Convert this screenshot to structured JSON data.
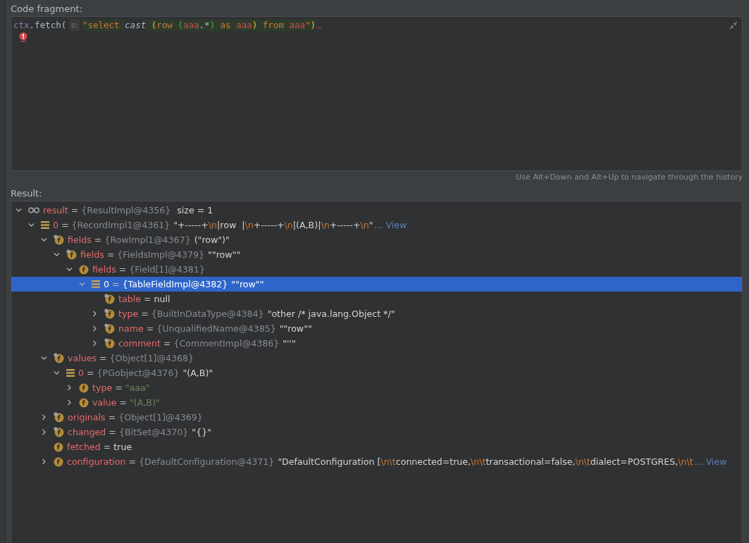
{
  "code_fragment": {
    "label": "Code fragment:",
    "tokens": [
      {
        "text": "ctx",
        "kind": "ident"
      },
      {
        "text": ".fetch(",
        "kind": "plain"
      },
      {
        "text": "s:",
        "kind": "hint"
      },
      {
        "text": "\"select ",
        "kind": "sqlkw"
      },
      {
        "text": "cast",
        "kind": "sqlfn"
      },
      {
        "text": " (",
        "kind": "paren1"
      },
      {
        "text": "row ",
        "kind": "sqlkw"
      },
      {
        "text": "(",
        "kind": "paren2"
      },
      {
        "text": "aaa",
        "kind": "table"
      },
      {
        "text": ".*",
        "kind": "op"
      },
      {
        "text": ")",
        "kind": "paren2"
      },
      {
        "text": " as ",
        "kind": "sqlkw"
      },
      {
        "text": "aaa",
        "kind": "table"
      },
      {
        "text": ")",
        "kind": "paren1"
      },
      {
        "text": " from ",
        "kind": "sqlkw"
      },
      {
        "text": "aaa",
        "kind": "table"
      },
      {
        "text": "\"",
        "kind": "sqlkw"
      },
      {
        "text": ")",
        "kind": "paren1"
      }
    ],
    "history_hint": "Use Alt+Down and Alt+Up to navigate through the history"
  },
  "result": {
    "label": "Result:",
    "tree": [
      {
        "kind": "watch",
        "name": "result",
        "eq": "=",
        "type": "{ResultImpl@4356}",
        "value": [
          {
            "text": " size = 1",
            "kind": "plain"
          }
        ],
        "expanded": true,
        "selected": false,
        "children": [
          {
            "kind": "array",
            "name": "0",
            "eq": "=",
            "type": "{RecordImpl1@4361}",
            "value": [
              {
                "text": "\"+-----+",
                "kind": "plain"
              },
              {
                "text": "\\n",
                "kind": "escape"
              },
              {
                "text": "|row  |",
                "kind": "plain"
              },
              {
                "text": "\\n",
                "kind": "escape"
              },
              {
                "text": "+-----+",
                "kind": "plain"
              },
              {
                "text": "\\n",
                "kind": "escape"
              },
              {
                "text": "|(A,B)|",
                "kind": "plain"
              },
              {
                "text": "\\n",
                "kind": "escape"
              },
              {
                "text": "+-----+",
                "kind": "plain"
              },
              {
                "text": "\\n",
                "kind": "escape"
              },
              {
                "text": "\"",
                "kind": "plain"
              }
            ],
            "more": "...",
            "link": "View",
            "expanded": true,
            "selected": false,
            "children": [
              {
                "kind": "field-final",
                "name": "fields",
                "eq": "=",
                "type": "{RowImpl1@4367}",
                "value": [
                  {
                    "text": "(\"row\")\"",
                    "kind": "plain"
                  }
                ],
                "expanded": true,
                "selected": false,
                "children": [
                  {
                    "kind": "field-final",
                    "name": "fields",
                    "eq": "=",
                    "type": "{FieldsImpl@4379}",
                    "value": [
                      {
                        "text": "\"\"row\"\"",
                        "kind": "plain"
                      }
                    ],
                    "expanded": true,
                    "selected": false,
                    "children": [
                      {
                        "kind": "field",
                        "name": "fields",
                        "eq": "=",
                        "type": "{Field[1]@4381}",
                        "expanded": true,
                        "selected": false,
                        "children": [
                          {
                            "kind": "array",
                            "name": "0",
                            "eq": "=",
                            "type": "{TableFieldImpl@4382}",
                            "value": [
                              {
                                "text": "\"\"row\"\"",
                                "kind": "plain"
                              }
                            ],
                            "expanded": true,
                            "selected": true,
                            "children": [
                              {
                                "kind": "field-final",
                                "name": "table",
                                "eq": "=",
                                "value": [
                                  {
                                    "text": "null",
                                    "kind": "plain"
                                  }
                                ],
                                "selected": false
                              },
                              {
                                "kind": "field-final",
                                "name": "type",
                                "eq": "=",
                                "type": "{BuiltInDataType@4384}",
                                "value": [
                                  {
                                    "text": "\"other /* java.lang.Object */\"",
                                    "kind": "plain"
                                  }
                                ],
                                "expanded": false,
                                "selected": false
                              },
                              {
                                "kind": "field-final",
                                "name": "name",
                                "eq": "=",
                                "type": "{UnqualifiedName@4385}",
                                "value": [
                                  {
                                    "text": "\"\"row\"\"",
                                    "kind": "plain"
                                  }
                                ],
                                "expanded": false,
                                "selected": false
                              },
                              {
                                "kind": "field-final",
                                "name": "comment",
                                "eq": "=",
                                "type": "{CommentImpl@4386}",
                                "value": [
                                  {
                                    "text": "\"''\"",
                                    "kind": "plain"
                                  }
                                ],
                                "expanded": false,
                                "selected": false
                              }
                            ]
                          }
                        ]
                      }
                    ]
                  }
                ]
              },
              {
                "kind": "field-final",
                "name": "values",
                "eq": "=",
                "type": "{Object[1]@4368}",
                "expanded": true,
                "selected": false,
                "children": [
                  {
                    "kind": "array",
                    "name": "0",
                    "eq": "=",
                    "type": "{PGobject@4376}",
                    "value": [
                      {
                        "text": "\"(A,B)\"",
                        "kind": "plain"
                      }
                    ],
                    "expanded": true,
                    "selected": false,
                    "children": [
                      {
                        "kind": "field",
                        "name": "type",
                        "eq": "=",
                        "value": [
                          {
                            "text": "\"aaa\"",
                            "kind": "string"
                          }
                        ],
                        "expanded": false,
                        "selected": false
                      },
                      {
                        "kind": "field",
                        "name": "value",
                        "eq": "=",
                        "value": [
                          {
                            "text": "\"(A,B)\"",
                            "kind": "string"
                          }
                        ],
                        "expanded": false,
                        "selected": false
                      }
                    ]
                  }
                ]
              },
              {
                "kind": "field-final",
                "name": "originals",
                "eq": "=",
                "type": "{Object[1]@4369}",
                "expanded": false,
                "selected": false
              },
              {
                "kind": "field-final",
                "name": "changed",
                "eq": "=",
                "type": "{BitSet@4370}",
                "value": [
                  {
                    "text": "\"{}\"",
                    "kind": "plain"
                  }
                ],
                "expanded": false,
                "selected": false
              },
              {
                "kind": "field",
                "name": "fetched",
                "eq": "=",
                "value": [
                  {
                    "text": "true",
                    "kind": "plain"
                  }
                ],
                "selected": false
              },
              {
                "kind": "field",
                "name": "configuration",
                "eq": "=",
                "type": "{DefaultConfiguration@4371}",
                "value": [
                  {
                    "text": "\"DefaultConfiguration [",
                    "kind": "plain"
                  },
                  {
                    "text": "\\n\\t",
                    "kind": "escape"
                  },
                  {
                    "text": "connected=true,",
                    "kind": "plain"
                  },
                  {
                    "text": "\\n\\t",
                    "kind": "escape"
                  },
                  {
                    "text": "transactional=false,",
                    "kind": "plain"
                  },
                  {
                    "text": "\\n\\t",
                    "kind": "escape"
                  },
                  {
                    "text": "dialect=POSTGRES,",
                    "kind": "plain"
                  },
                  {
                    "text": "\\n\\t",
                    "kind": "escape"
                  }
                ],
                "more": "...",
                "link": "View",
                "expanded": false,
                "selected": false
              }
            ]
          }
        ]
      }
    ]
  }
}
